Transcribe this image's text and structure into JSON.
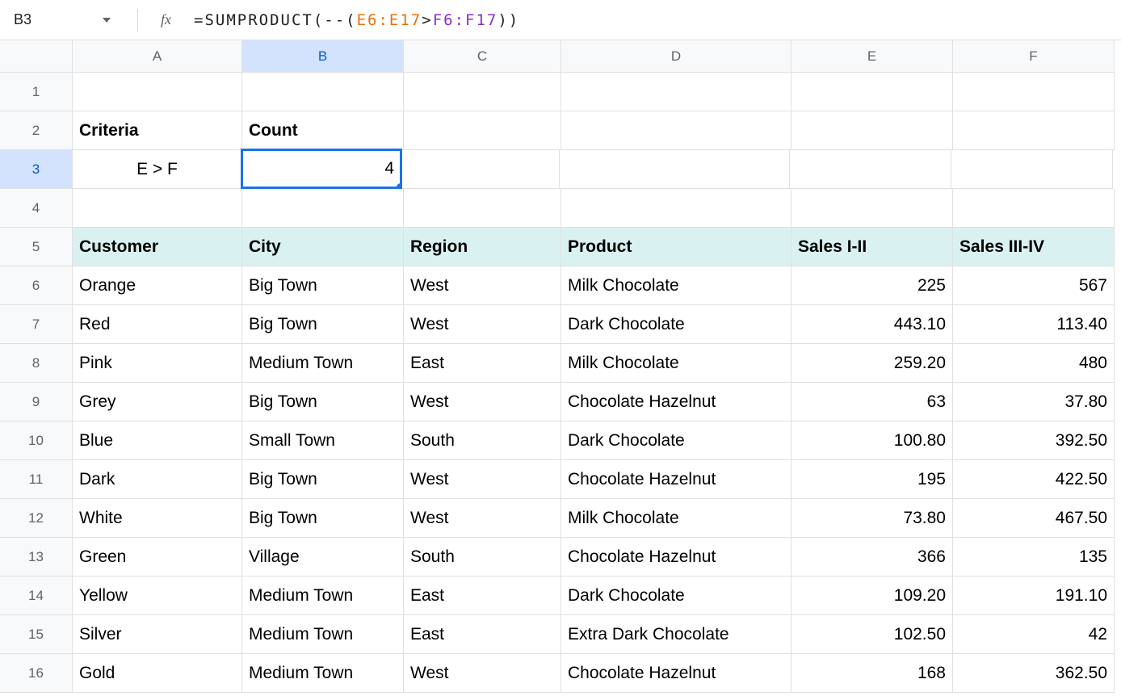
{
  "nameBox": "B3",
  "formula": {
    "prefix": "=",
    "func": "SUMPRODUCT",
    "openParen": "(--(",
    "range1": "E6:E17",
    "operator": ">",
    "range2": "F6:F17",
    "closeParen": "))"
  },
  "columns": [
    "A",
    "B",
    "C",
    "D",
    "E",
    "F"
  ],
  "selectedColumn": "B",
  "selectedRow": 3,
  "rows": [
    1,
    2,
    3,
    4,
    5,
    6,
    7,
    8,
    9,
    10,
    11,
    12,
    13,
    14,
    15,
    16
  ],
  "labels": {
    "criteria": "Criteria",
    "count": "Count",
    "criteriaValue": "E > F",
    "countValue": "4"
  },
  "tableHeaders": {
    "customer": "Customer",
    "city": "City",
    "region": "Region",
    "product": "Product",
    "salesI": "Sales I-II",
    "salesII": "Sales III-IV"
  },
  "tableData": [
    {
      "customer": "Orange",
      "city": "Big Town",
      "region": "West",
      "product": "Milk Chocolate",
      "s1": "225",
      "s2": "567"
    },
    {
      "customer": "Red",
      "city": "Big Town",
      "region": "West",
      "product": "Dark Chocolate",
      "s1": "443.10",
      "s2": "113.40"
    },
    {
      "customer": "Pink",
      "city": "Medium Town",
      "region": "East",
      "product": "Milk Chocolate",
      "s1": "259.20",
      "s2": "480"
    },
    {
      "customer": "Grey",
      "city": "Big Town",
      "region": "West",
      "product": "Chocolate Hazelnut",
      "s1": "63",
      "s2": "37.80"
    },
    {
      "customer": "Blue",
      "city": "Small Town",
      "region": "South",
      "product": "Dark Chocolate",
      "s1": "100.80",
      "s2": "392.50"
    },
    {
      "customer": "Dark",
      "city": "Big Town",
      "region": "West",
      "product": "Chocolate Hazelnut",
      "s1": "195",
      "s2": "422.50"
    },
    {
      "customer": "White",
      "city": "Big Town",
      "region": "West",
      "product": "Milk Chocolate",
      "s1": "73.80",
      "s2": "467.50"
    },
    {
      "customer": "Green",
      "city": "Village",
      "region": "South",
      "product": "Chocolate Hazelnut",
      "s1": "366",
      "s2": "135"
    },
    {
      "customer": "Yellow",
      "city": "Medium Town",
      "region": "East",
      "product": "Dark Chocolate",
      "s1": "109.20",
      "s2": "191.10"
    },
    {
      "customer": "Silver",
      "city": "Medium Town",
      "region": "East",
      "product": "Extra Dark Chocolate",
      "s1": "102.50",
      "s2": "42"
    },
    {
      "customer": "Gold",
      "city": "Medium Town",
      "region": "West",
      "product": "Chocolate Hazelnut",
      "s1": "168",
      "s2": "362.50"
    }
  ]
}
